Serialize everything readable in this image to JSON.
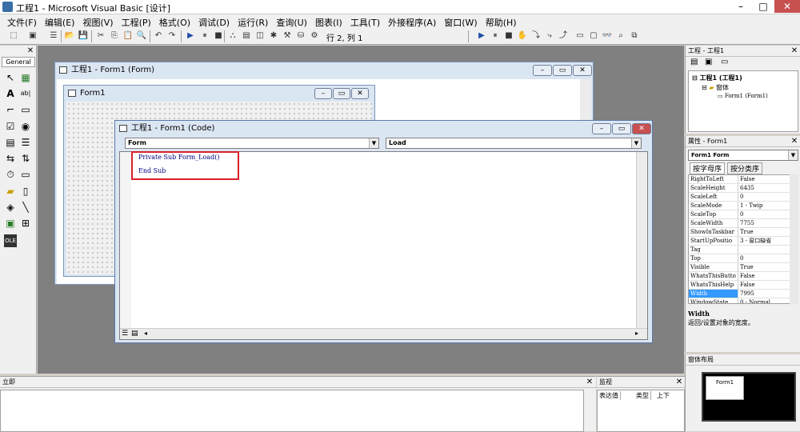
{
  "window": {
    "title": "工程1 - Microsoft Visual Basic [设计]"
  },
  "menu": [
    "文件(F)",
    "编辑(E)",
    "视图(V)",
    "工程(P)",
    "格式(O)",
    "调试(D)",
    "运行(R)",
    "查询(U)",
    "图表(I)",
    "工具(T)",
    "外接程序(A)",
    "窗口(W)",
    "帮助(H)"
  ],
  "toolbar": {
    "position": "行 2, 列 1"
  },
  "toolbox": {
    "tab": "General"
  },
  "form_window": {
    "title": "工程1 - Form1 (Form)",
    "inner_title": "Form1"
  },
  "code_window": {
    "title": "工程1 - Form1 (Code)",
    "object_combo": "Form",
    "proc_combo": "Load",
    "lines": [
      "Private Sub Form_Load()",
      "End Sub"
    ]
  },
  "project_panel": {
    "title": "工程 - 工程1",
    "root": "工程1 (工程1)",
    "folder": "窗体",
    "item": "Form1 (Form1)"
  },
  "props_panel": {
    "title": "属性 - Form1",
    "object": "Form1 Form",
    "tabs": [
      "按字母序",
      "按分类序"
    ],
    "rows": [
      [
        "RightToLeft",
        "False"
      ],
      [
        "ScaleHeight",
        "6435"
      ],
      [
        "ScaleLeft",
        "0"
      ],
      [
        "ScaleMode",
        "1 - Twip"
      ],
      [
        "ScaleTop",
        "0"
      ],
      [
        "ScaleWidth",
        "7755"
      ],
      [
        "ShowInTaskbar",
        "True"
      ],
      [
        "StartUpPositio",
        "3 - 窗口缺省"
      ],
      [
        "Tag",
        ""
      ],
      [
        "Top",
        "0"
      ],
      [
        "Visible",
        "True"
      ],
      [
        "WhatsThisButto",
        "False"
      ],
      [
        "WhatsThisHelp",
        "False"
      ],
      [
        "Width",
        "7995"
      ],
      [
        "WindowState",
        "0 - Normal"
      ]
    ],
    "desc_title": "Width",
    "desc_text": "返回/设置对象的宽度。"
  },
  "layout_panel": {
    "title": "窗体布局",
    "form_label": "Form1"
  },
  "immediate_panel": {
    "title": "立即"
  },
  "watch_panel": {
    "title": "监视",
    "cols": [
      "表达值",
      "类型",
      "上下"
    ]
  }
}
